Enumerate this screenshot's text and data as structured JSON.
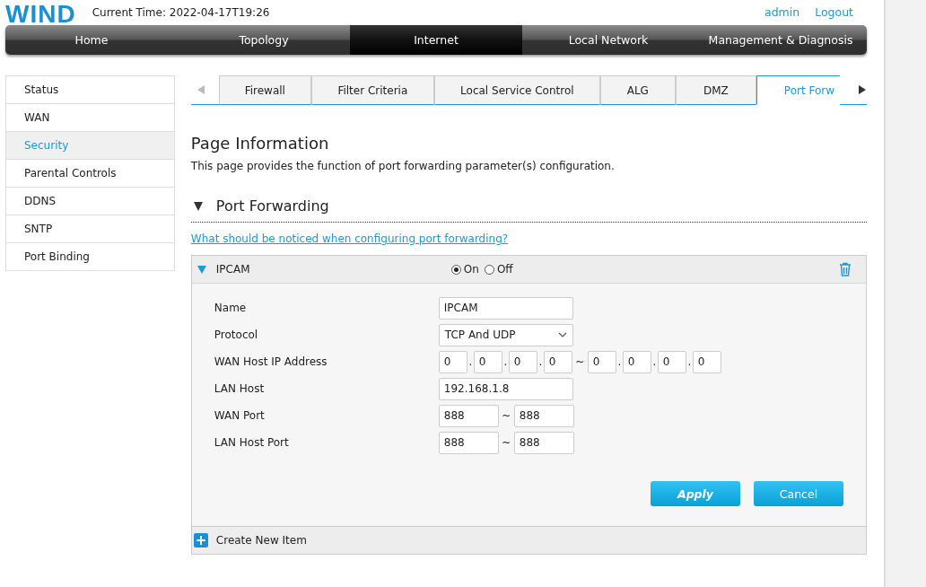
{
  "header": {
    "logo": "WIND",
    "current_time_label": "Current Time:",
    "current_time": "2022-04-17T19:26",
    "user": "admin",
    "logout": "Logout"
  },
  "nav": [
    {
      "label": "Home",
      "selected": false
    },
    {
      "label": "Topology",
      "selected": false
    },
    {
      "label": "Internet",
      "selected": true
    },
    {
      "label": "Local Network",
      "selected": false
    },
    {
      "label": "Management & Diagnosis",
      "selected": false
    }
  ],
  "sidebar": {
    "items": [
      {
        "label": "Status",
        "selected": false
      },
      {
        "label": "WAN",
        "selected": false
      },
      {
        "label": "Security",
        "selected": true
      },
      {
        "label": "Parental Controls",
        "selected": false
      },
      {
        "label": "DDNS",
        "selected": false
      },
      {
        "label": "SNTP",
        "selected": false
      },
      {
        "label": "Port Binding",
        "selected": false
      }
    ]
  },
  "tabs": [
    {
      "label": "Firewall",
      "selected": false
    },
    {
      "label": "Filter Criteria",
      "selected": false
    },
    {
      "label": "Local Service Control",
      "selected": false
    },
    {
      "label": "ALG",
      "selected": false
    },
    {
      "label": "DMZ",
      "selected": false
    },
    {
      "label": "Port Forw",
      "selected": true
    }
  ],
  "page_info": {
    "title": "Page Information",
    "description": "This page provides the function of port forwarding parameter(s) configuration."
  },
  "section": {
    "title": "Port Forwarding",
    "expanded": true,
    "help_link": "What should be noticed when configuring port forwarding?"
  },
  "entry": {
    "name": "IPCAM",
    "expanded": true,
    "options": [
      {
        "label": "On",
        "selected": true
      },
      {
        "label": "Off",
        "selected": false
      }
    ],
    "fields": [
      {
        "kind": "text",
        "label": "Name",
        "value": "IPCAM"
      },
      {
        "kind": "select",
        "label": "Protocol",
        "value": "TCP And UDP"
      },
      {
        "kind": "ip_range",
        "label": "WAN Host IP Address",
        "start": [
          "0",
          "0",
          "0",
          "0"
        ],
        "start_separators": [
          ".",
          ".",
          "."
        ],
        "range_separator": "~",
        "end": [
          "0",
          "0",
          "0",
          "0"
        ],
        "end_separators": [
          ".",
          ".",
          "."
        ]
      },
      {
        "kind": "text",
        "label": "LAN Host",
        "value": "192.168.1.8"
      },
      {
        "kind": "range",
        "label": "WAN Port",
        "start": "888",
        "range_separator": "~",
        "end": "888"
      },
      {
        "kind": "range",
        "label": "LAN Host Port",
        "start": "888",
        "range_separator": "~",
        "end": "888"
      }
    ],
    "buttons": [
      {
        "label": "Apply",
        "kind": "primary"
      },
      {
        "label": "Cancel",
        "kind": "secondary"
      }
    ]
  },
  "create_new": "Create New Item"
}
